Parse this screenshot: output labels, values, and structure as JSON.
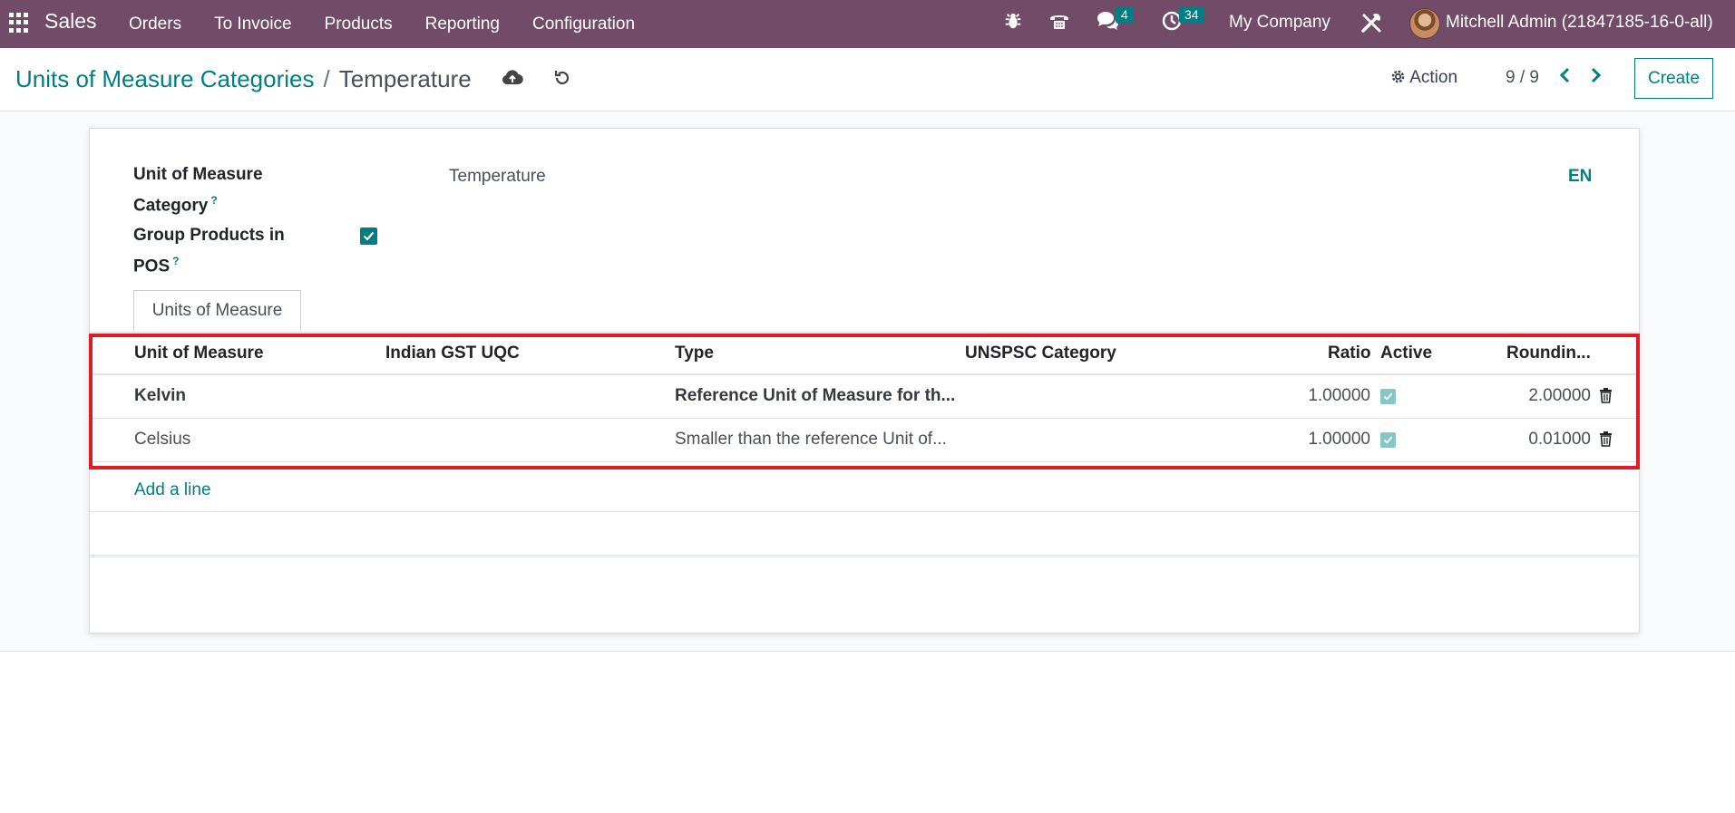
{
  "navbar": {
    "app_name": "Sales",
    "menu": [
      "Orders",
      "To Invoice",
      "Products",
      "Reporting",
      "Configuration"
    ],
    "messages_count": "4",
    "activities_count": "34",
    "company": "My Company",
    "user": "Mitchell Admin (21847185-16-0-all)",
    "bg_color": "#714B67"
  },
  "control_panel": {
    "breadcrumb_parent": "Units of Measure Categories",
    "breadcrumb_sep": "/",
    "breadcrumb_current": "Temperature",
    "action_label": "Action",
    "pager": "9 / 9",
    "create_label": "Create"
  },
  "form": {
    "category_label": "Unit of Measure Category",
    "category_label_line1": "Unit of Measure",
    "category_label_line2": "Category",
    "category_value": "Temperature",
    "group_label_line1": "Group Products in",
    "group_label_line2": "POS",
    "group_value": true,
    "help_mark": "?",
    "lang": "EN"
  },
  "tab": {
    "label": "Units of Measure"
  },
  "table": {
    "columns": [
      "Unit of Measure",
      "Indian GST UQC",
      "Type",
      "UNSPSC Category",
      "Ratio",
      "Active",
      "Roundin..."
    ],
    "rows": [
      {
        "uom": "Kelvin",
        "gst": "",
        "type": "Reference Unit of Measure for th...",
        "unspsc": "",
        "ratio": "1.00000",
        "active": true,
        "rounding": "2.00000"
      },
      {
        "uom": "Celsius",
        "gst": "",
        "type": "Smaller than the reference Unit of...",
        "unspsc": "",
        "ratio": "1.00000",
        "active": true,
        "rounding": "0.01000"
      }
    ],
    "add_line": "Add a line"
  },
  "accent_color": "#017E84",
  "highlight_color": "#e01b24"
}
